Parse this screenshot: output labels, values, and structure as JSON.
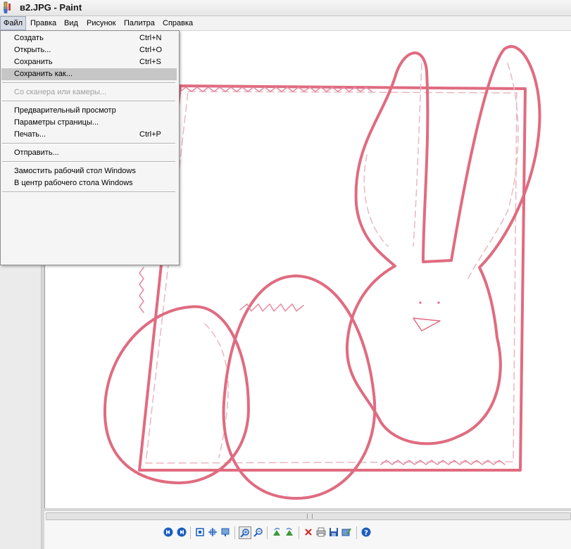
{
  "window": {
    "title": "в2.JPG - Paint",
    "app_icon": "paint-brush-icon"
  },
  "menubar": {
    "items": [
      "Файл",
      "Правка",
      "Вид",
      "Рисунок",
      "Палитра",
      "Справка"
    ],
    "active": "Файл"
  },
  "file_menu": {
    "items": [
      {
        "label": "Создать",
        "shortcut": "Ctrl+N"
      },
      {
        "label": "Открыть...",
        "shortcut": "Ctrl+O"
      },
      {
        "label": "Сохранить",
        "shortcut": "Ctrl+S"
      },
      {
        "label": "Сохранить как...",
        "shortcut": "",
        "highlighted": true
      },
      {
        "label": "Со сканера или камеры...",
        "shortcut": "",
        "disabled": true
      },
      {
        "label": "Предварительный просмотр",
        "shortcut": ""
      },
      {
        "label": "Параметры страницы...",
        "shortcut": ""
      },
      {
        "label": "Печать...",
        "shortcut": "Ctrl+P"
      },
      {
        "label": "Отправить...",
        "shortcut": ""
      },
      {
        "label": "Замостить рабочий стол Windows",
        "shortcut": ""
      },
      {
        "label": "В центр рабочего стола Windows",
        "shortcut": ""
      }
    ]
  },
  "canvas": {
    "image": "easter-bunny-eggs-pattern-drawing",
    "stroke_color": "#e06b80",
    "stitch_color": "#e8b8c0"
  },
  "viewer_toolbar": {
    "icons": [
      "previous-image-icon",
      "next-image-icon",
      "best-fit-icon",
      "actual-size-icon",
      "slideshow-icon",
      "zoom-in-icon",
      "zoom-out-icon",
      "rotate-clockwise-icon",
      "rotate-counterclockwise-icon",
      "delete-icon",
      "print-icon",
      "save-icon",
      "edit-icon",
      "help-icon"
    ]
  },
  "colors": {
    "menu_highlight": "#c6c6c6",
    "canvas_bg": "#ffffff",
    "accent_blue": "#1b5fbf"
  }
}
